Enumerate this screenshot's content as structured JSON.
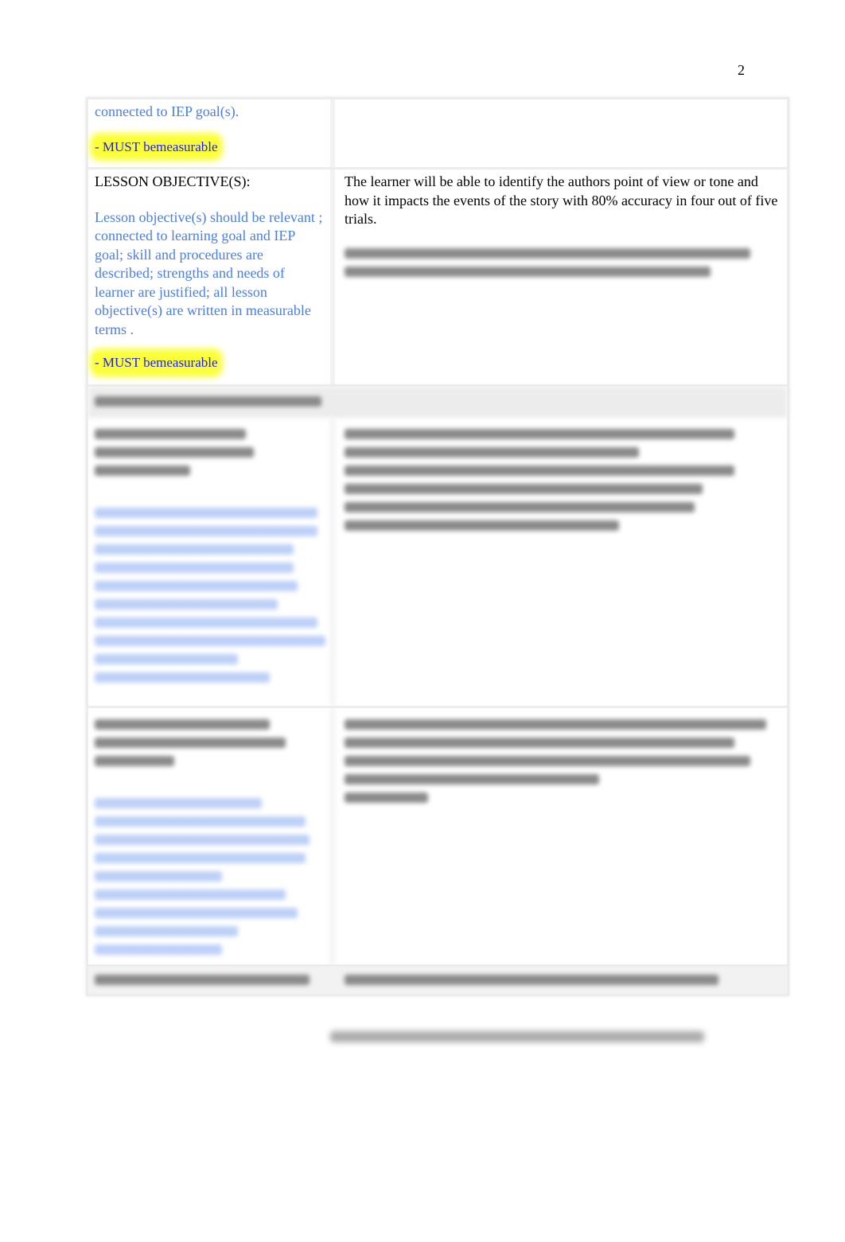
{
  "page_number": "2",
  "rows": [
    {
      "left_guidance": "connected to IEP goal(s).",
      "left_highlight": "- MUST bemeasurable"
    },
    {
      "left_label": "LESSON OBJECTIVE(S):",
      "left_guidance": "Lesson objective(s) should be relevant ; connected to learning goal and IEP goal; skill and procedures are described; strengths and needs  of learner are justified; all lesson objective(s) are written in measurable terms .",
      "left_highlight": "- MUST bemeasurable",
      "right_text": "The learner will be able to identify the authors point of view or tone and how it impacts the events of the story with 80% accuracy in four out of five trials."
    }
  ],
  "colors": {
    "guidance_text": "#4a7ee6",
    "highlight": "#fbff3a",
    "highlight_text": "#1a1aff"
  }
}
